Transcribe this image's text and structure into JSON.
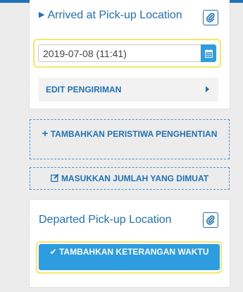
{
  "colors": {
    "accent": "#1f72b5",
    "button": "#2d9de0",
    "highlight": "#f2e96a"
  },
  "stop_arrived": {
    "title": "Arrived at Pick-up Location",
    "date_value": "2019-07-08  (11:41)",
    "edit_label": "EDIT PENGIRIMAN"
  },
  "actions": {
    "add_stop_event": "TAMBAHKAN PERISTIWA PENGHENTIAN",
    "enter_loaded_qty": "MASUKKAN JUMLAH YANG DIMUAT"
  },
  "stop_departed": {
    "title": "Departed Pick-up Location",
    "add_time_note": "TAMBAHKAN KETERANGAN WAKTU"
  }
}
